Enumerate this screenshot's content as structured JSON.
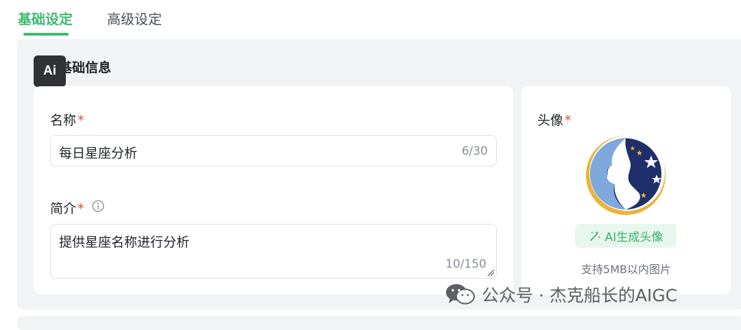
{
  "tabs": {
    "basic": "基础设定",
    "advanced": "高级设定"
  },
  "section": {
    "title": "基础信息",
    "badge": "Ai"
  },
  "name_field": {
    "label": "名称",
    "required": "*",
    "value": "每日星座分析",
    "counter": "6/30"
  },
  "intro_field": {
    "label": "简介",
    "required": "*",
    "value": "提供星座名称进行分析",
    "counter": "10/150"
  },
  "avatar": {
    "label": "头像",
    "required": "*",
    "ai_button": "AI生成头像",
    "hint": "支持5MB以内图片"
  },
  "watermark": "公众号 · 杰克船长的AIGC",
  "colors": {
    "accent": "#3dba6f",
    "required": "#e0463d",
    "panel": "#f2f3f5"
  }
}
